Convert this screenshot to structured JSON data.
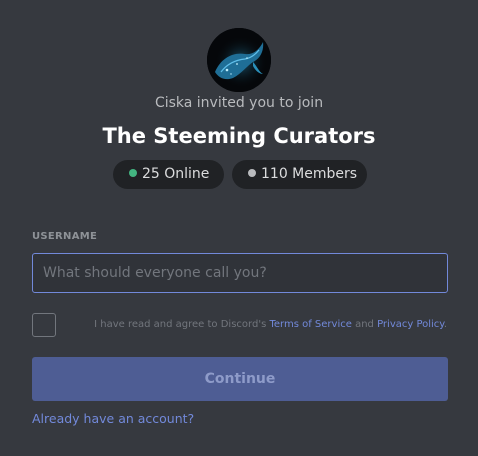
{
  "invite": {
    "inviter_text": "Ciska invited you to join",
    "server_name": "The Steeming Curators",
    "online_text": "25 Online",
    "members_text": "110 Members"
  },
  "form": {
    "username_label": "USERNAME",
    "username_placeholder": "What should everyone call you?",
    "username_value": "",
    "agree_prefix": "I have read and agree to Discord's",
    "terms_link": "Terms of Service",
    "agree_and": "and",
    "privacy_link": "Privacy Policy",
    "agree_suffix": ".",
    "continue_label": "Continue",
    "login_link": "Already have an account?"
  },
  "colors": {
    "background": "#36393f",
    "accent": "#7289da",
    "online_dot": "#43b581",
    "members_dot": "#b9bbbe",
    "button_disabled": "#4e5d94"
  },
  "icons": {
    "avatar": "whale-server-icon"
  }
}
